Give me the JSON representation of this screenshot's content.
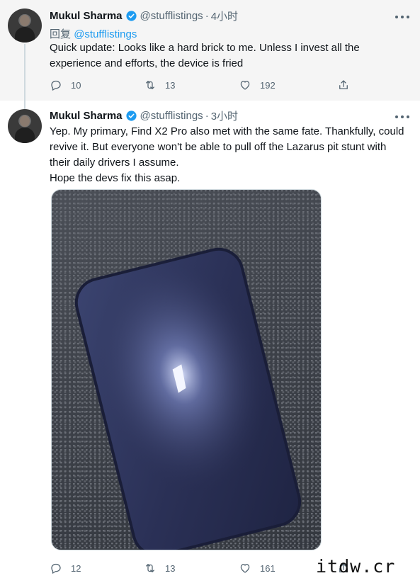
{
  "tweets": [
    {
      "author_name": "Mukul Sharma",
      "author_handle": "@stufflistings",
      "separator": "·",
      "time": "4小时",
      "replying_prefix": "回复",
      "replying_to": "@stufflistings",
      "text_lines": [
        "Quick update: Looks like a hard brick to me. Unless I invest all the",
        "experience and efforts, the device is fried"
      ],
      "replies": "10",
      "retweets": "13",
      "likes": "192"
    },
    {
      "author_name": "Mukul Sharma",
      "author_handle": "@stufflistings",
      "separator": "·",
      "time": "3小时",
      "text_lines": [
        "Yep. My primary, Find X2 Pro also met with the same fate. Thankfully, could",
        "revive it. But everyone won't be able to pull off the Lazarus pit stunt with",
        "their daily drivers I assume.",
        "Hope the devs fix this asap."
      ],
      "replies": "12",
      "retweets": "13",
      "likes": "161"
    }
  ],
  "icons": {
    "verified": "verified-badge-icon",
    "reply": "reply-icon",
    "retweet": "retweet-icon",
    "like": "heart-icon",
    "share": "share-icon",
    "more": "more-icon"
  },
  "colors": {
    "accent": "#1d9bf0",
    "secondary_text": "#536471",
    "primary_text": "#0f1419",
    "reply_background": "#f5f5f5"
  },
  "watermark": "itdw.cr"
}
